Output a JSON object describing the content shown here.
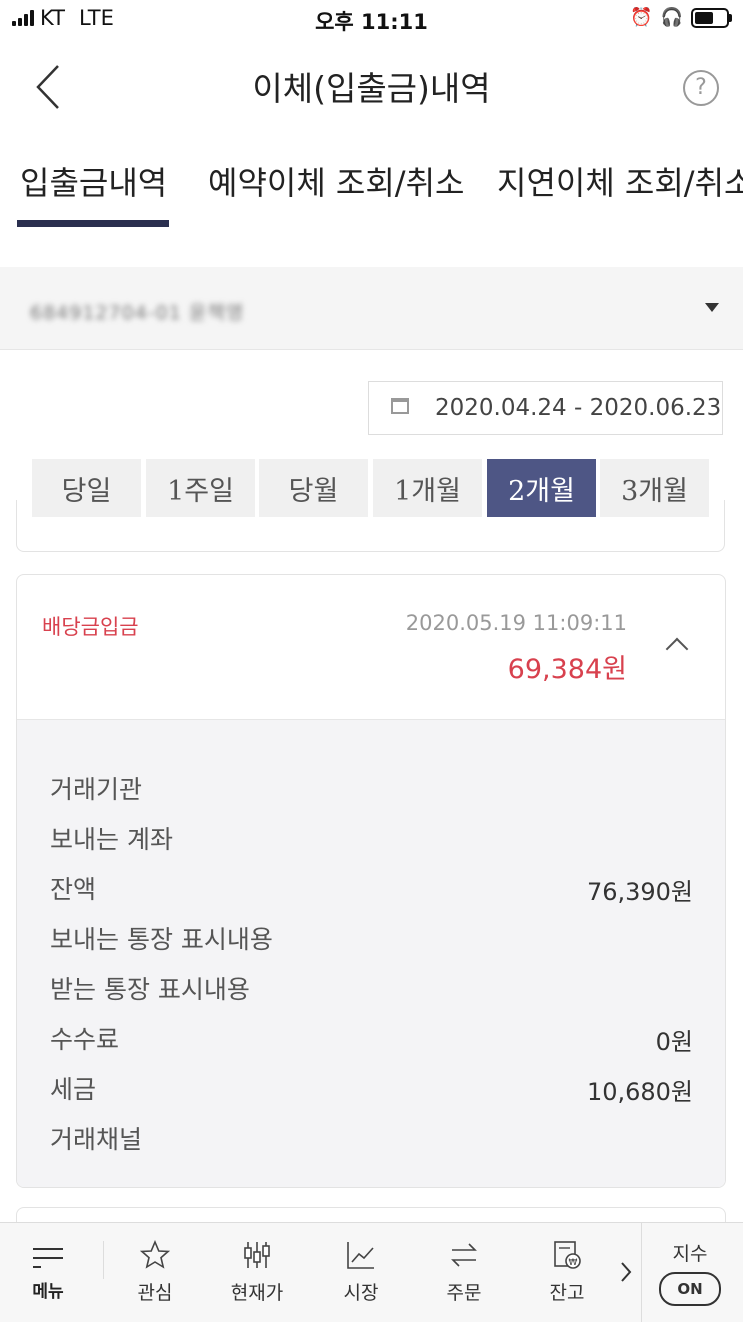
{
  "status_bar": {
    "carrier": "KT",
    "network": "LTE",
    "time": "오후 11:11"
  },
  "header": {
    "title": "이체(입출금)내역",
    "help_label": "?"
  },
  "tabs": [
    {
      "label": "입출금내역",
      "active": true
    },
    {
      "label": "예약이체 조회/취소",
      "active": false
    },
    {
      "label": "지연이체 조회/취소",
      "active": false
    }
  ],
  "account": {
    "masked_value": "684912704-01 윤책영"
  },
  "date_range": {
    "text": "2020.04.24 - 2020.06.23"
  },
  "periods": [
    {
      "label": "당일",
      "active": false
    },
    {
      "label": "1주일",
      "active": false
    },
    {
      "label": "당월",
      "active": false
    },
    {
      "label": "1개월",
      "active": false
    },
    {
      "label": "2개월",
      "active": true
    },
    {
      "label": "3개월",
      "active": false
    }
  ],
  "transaction": {
    "type": "배당금입금",
    "datetime": "2020.05.19  11:09:11",
    "amount": "69,384원",
    "details": [
      {
        "label": "거래기관",
        "value": ""
      },
      {
        "label": "보내는 계좌",
        "value": ""
      },
      {
        "label": "잔액",
        "value": "76,390원"
      },
      {
        "label": "보내는 통장 표시내용",
        "value": ""
      },
      {
        "label": "받는 통장 표시내용",
        "value": ""
      },
      {
        "label": "수수료",
        "value": "0원"
      },
      {
        "label": "세금",
        "value": "10,680원"
      },
      {
        "label": "거래채널",
        "value": ""
      }
    ]
  },
  "colors": {
    "accent": "#4e5685",
    "amount_red": "#d8414e",
    "tab_underline": "#2a2f4f"
  },
  "bottom_nav": {
    "menu": "메뉴",
    "items": [
      {
        "label": "관심",
        "icon": "star-icon"
      },
      {
        "label": "현재가",
        "icon": "price-icon"
      },
      {
        "label": "시장",
        "icon": "market-chart-icon"
      },
      {
        "label": "주문",
        "icon": "order-swap-icon"
      },
      {
        "label": "잔고",
        "icon": "balance-icon"
      }
    ],
    "index_label": "지수",
    "index_toggle": "ON"
  }
}
